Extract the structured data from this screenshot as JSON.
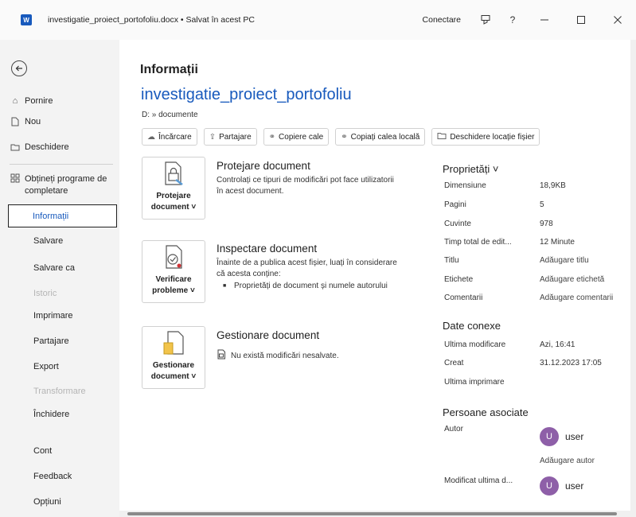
{
  "titlebar": {
    "app_icon": "W",
    "title": "investigatie_proiect_portofoliu.docx • Salvat în acest PC",
    "connect": "Conectare",
    "help": "?",
    "icons": [
      "ribbon-display-icon",
      "help-icon",
      "minimize-icon",
      "maximize-icon",
      "close-icon"
    ]
  },
  "nav": {
    "top": [
      {
        "label": "Pornire",
        "icon": "home-icon"
      },
      {
        "label": "Nou",
        "icon": "new-document-icon"
      },
      {
        "label": "Deschidere",
        "icon": "folder-open-icon"
      }
    ],
    "addins": {
      "label": "Obțineți programe de completare",
      "icon": "addins-icon"
    },
    "items": [
      {
        "label": "Informații",
        "state": "selected"
      },
      {
        "label": "Salvare",
        "state": "normal"
      },
      {
        "label": "Salvare ca",
        "state": "normal"
      },
      {
        "label": "Istoric",
        "state": "disabled"
      },
      {
        "label": "Imprimare",
        "state": "normal"
      },
      {
        "label": "Partajare",
        "state": "normal"
      },
      {
        "label": "Export",
        "state": "normal"
      },
      {
        "label": "Transformare",
        "state": "disabled"
      },
      {
        "label": "Închidere",
        "state": "normal"
      }
    ],
    "bottom": [
      "Cont",
      "Feedback",
      "Opțiuni"
    ]
  },
  "main": {
    "page_title": "Informații",
    "doc_name": "investigatie_proiect_portofoliu",
    "doc_path": "D: » documente",
    "actions": [
      {
        "label": "Încărcare",
        "icon": "upload-icon"
      },
      {
        "label": "Partajare",
        "icon": "share-icon"
      },
      {
        "label": "Copiere cale",
        "icon": "link-icon"
      },
      {
        "label": "Copiați calea locală",
        "icon": "link-icon"
      },
      {
        "label": "Deschidere locație fișier",
        "icon": "folder-icon"
      }
    ],
    "protect": {
      "tile_line1": "Protejare",
      "tile_line2": "document ˅",
      "heading": "Protejare document",
      "desc": "Controlați ce tipuri de modificări pot face utilizatorii în acest document."
    },
    "inspect": {
      "tile_line1": "Verificare",
      "tile_line2": "probleme ˅",
      "heading": "Inspectare document",
      "desc": "Înainte de a publica acest fișier, luați în considerare că acesta conține:",
      "bullet": "Proprietăți de document și numele autorului"
    },
    "manage": {
      "tile_line1": "Gestionare",
      "tile_line2": "document ˅",
      "heading": "Gestionare document",
      "status": "Nu există modificări nesalvate."
    }
  },
  "properties": {
    "heading": "Proprietăți ˅",
    "rows": [
      {
        "label": "Dimensiune",
        "value": "18,9KB"
      },
      {
        "label": "Pagini",
        "value": "5"
      },
      {
        "label": "Cuvinte",
        "value": "978"
      },
      {
        "label": "Timp total de edit...",
        "value": "12 Minute"
      },
      {
        "label": "Titlu",
        "value": "Adăugare titlu"
      },
      {
        "label": "Etichete",
        "value": "Adăugare etichetă"
      },
      {
        "label": "Comentarii",
        "value": "Adăugare comentarii"
      }
    ],
    "dates_heading": "Date conexe",
    "dates": [
      {
        "label": "Ultima modificare",
        "value": "Azi, 16:41"
      },
      {
        "label": "Creat",
        "value": "31.12.2023 17:05"
      },
      {
        "label": "Ultima imprimare",
        "value": ""
      }
    ],
    "people_heading": "Persoane asociate",
    "author_label": "Autor",
    "author_initial": "U",
    "author_name": "user",
    "add_author": "Adăugare autor",
    "modified_label": "Modificat ultima d...",
    "modified_initial": "U",
    "modified_name": "user",
    "avatar_color": "#8e5fa8"
  }
}
